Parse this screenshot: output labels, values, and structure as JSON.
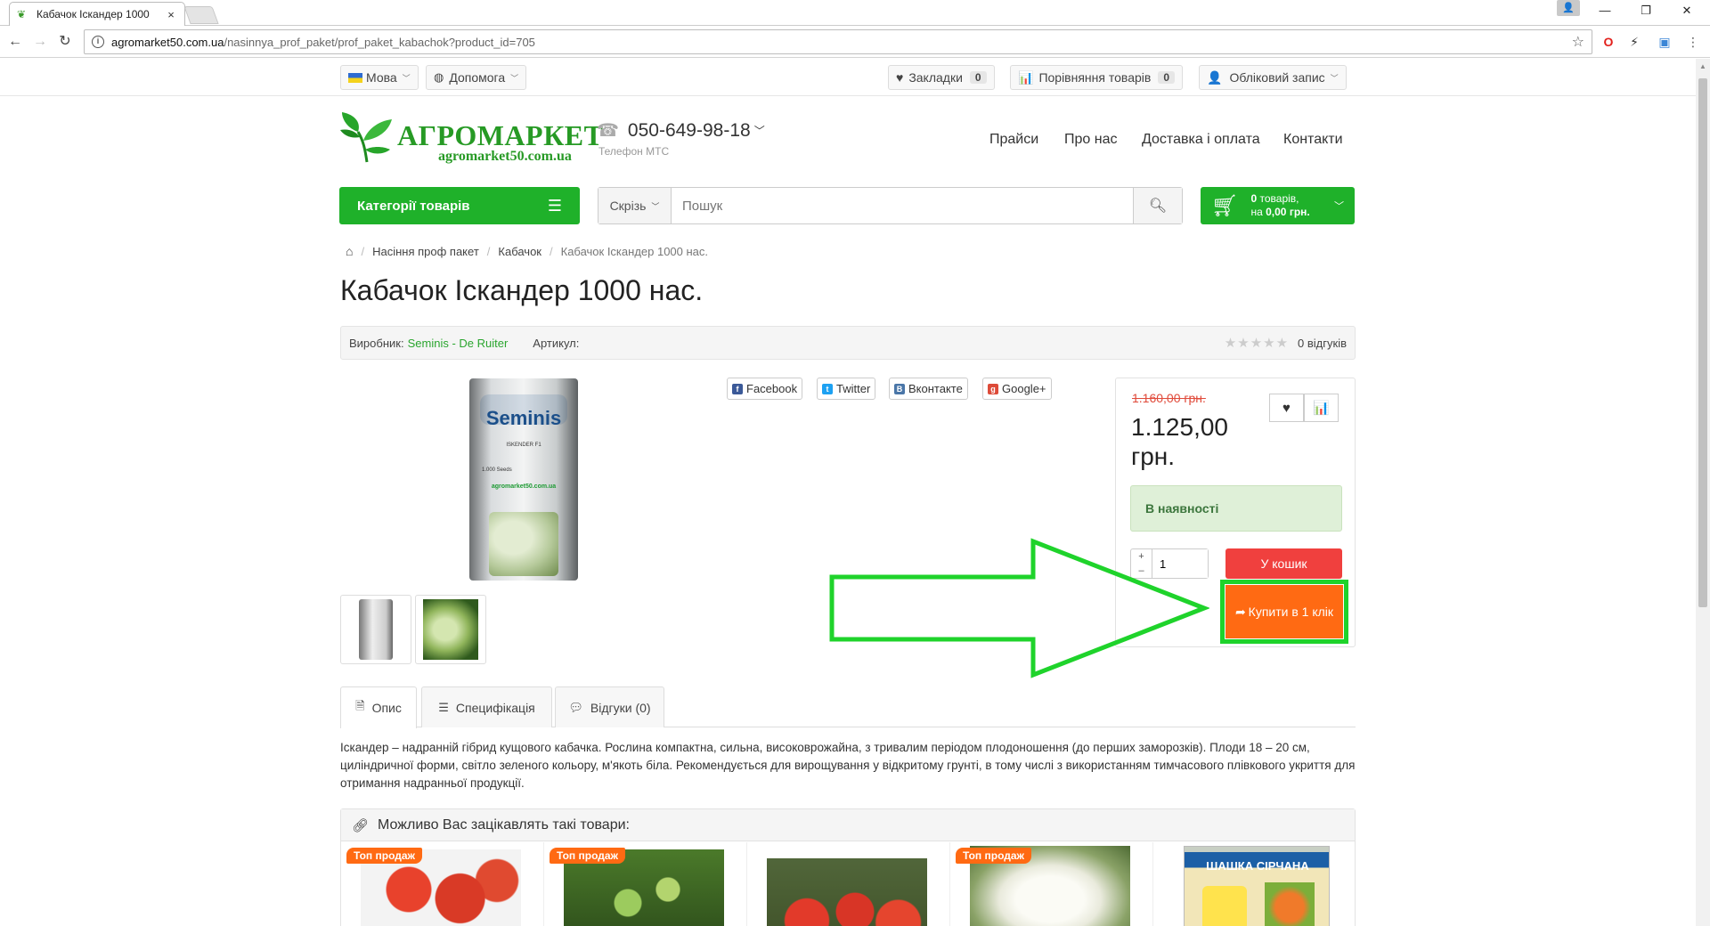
{
  "browser": {
    "tab_title": "Кабачок Іскандер 1000",
    "tab_close": "×",
    "url_host": "agromarket50.com.ua",
    "url_path": "/nasinnya_prof_paket/prof_paket_kabachok?product_id=705"
  },
  "topbar": {
    "language": "Мова",
    "help": "Допомога",
    "bookmarks": "Закладки",
    "bookmarks_count": "0",
    "compare": "Порівняння товарів",
    "compare_count": "0",
    "account": "Обліковий запис"
  },
  "header": {
    "logo_name": "АГРОМАРКЕТ",
    "logo_site": "agromarket50.com.ua",
    "phone": "050-649-98-18",
    "phone_note": "Телефон МТС",
    "nav": [
      "Прайси",
      "Про нас",
      "Доставка і оплата",
      "Контакти"
    ],
    "categories_button": "Категорії товарів",
    "search_scope": "Скрізь",
    "search_placeholder": "Пошук",
    "cart_line1": "товарів,",
    "cart_count": "0",
    "cart_line2_prefix": "на",
    "cart_total": "0,00 грн."
  },
  "breadcrumb": [
    "Насіння проф пакет",
    "Кабачок",
    "Кабачок Іскандер 1000 нас."
  ],
  "product": {
    "title": "Кабачок Іскандер 1000 нас.",
    "manufacturer_label": "Виробник:",
    "manufacturer": "Seminis - De Ruiter",
    "sku_label": "Артикул:",
    "rating_stars": 0,
    "reviews": "0 відгуків",
    "image_brand": "Seminis",
    "image_line1": "ISKENDER F1",
    "image_line2": "1.000 Seeds",
    "image_site": "agromarket50.com.ua",
    "share": [
      "Facebook",
      "Twitter",
      "Вконтакте",
      "Google+"
    ],
    "old_price": "1.160,00 грн.",
    "price": "1.125,00 грн.",
    "stock": "В наявності",
    "quantity": "1",
    "qty_plus": "+",
    "qty_minus": "–",
    "add_to_cart": "У кошик",
    "buy_one_click": "Купити в 1 клік"
  },
  "tabs": [
    "Опис",
    "Специфікація",
    "Відгуки (0)"
  ],
  "description": "Іскандер – надранній гібрид кущового кабачка. Рослина компактна, сильна, високоврожайна, з тривалим періодом плодоношення (до перших заморозків). Плоди 18 – 20 см, циліндричної форми, світло зеленого кольору, м'якоть біла. Рекомендується для вирощування у відкритому грунті, в тому числі з використанням тимчасового плівкового укриття для отримання надранньої продукції.",
  "related": {
    "heading": "Можливо Вас зацікавлять такі товари:",
    "badge": "Топ продаж",
    "box_text": "ШАШКА СІРЧАНА"
  },
  "colors": {
    "brand_green": "#1fb12a",
    "link_green": "#2aa52e",
    "cart_red": "#f0403e",
    "buy_orange": "#ff6a13",
    "annotation_green": "#1fd32b",
    "old_price_red": "#e04a3a"
  }
}
